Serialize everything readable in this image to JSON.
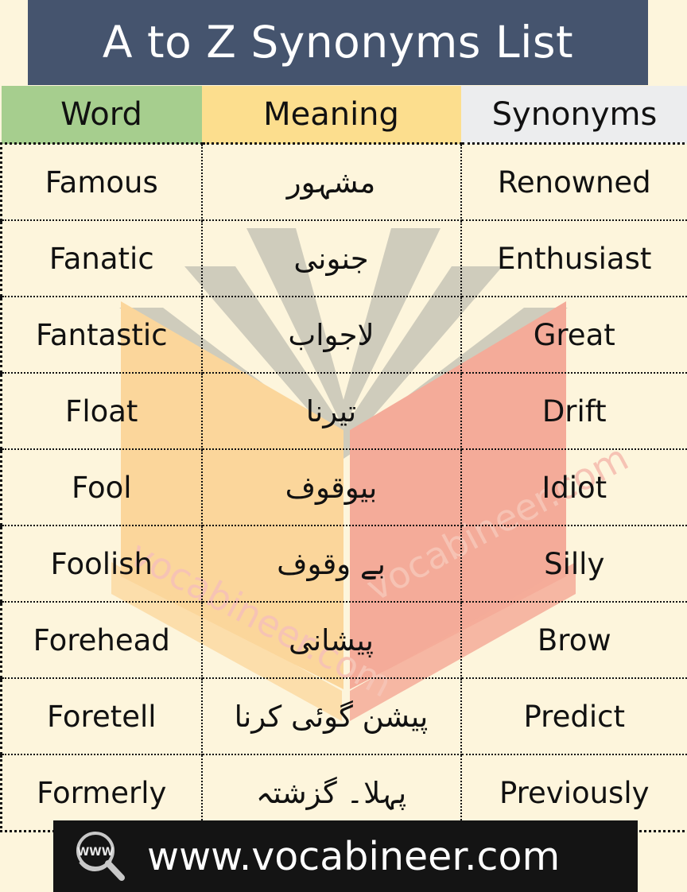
{
  "header": {
    "title": "A to Z Synonyms List",
    "title_bg": "#45546E",
    "title_color": "#FFFFFF"
  },
  "table": {
    "columns": [
      {
        "label": "Word",
        "bg": "#A6CE8E"
      },
      {
        "label": "Meaning",
        "bg": "#FCDE8E"
      },
      {
        "label": "Synonyms",
        "bg": "#ECEDEE"
      }
    ],
    "rows": [
      {
        "word": "Famous",
        "meaning": "مشہور",
        "synonym": "Renowned"
      },
      {
        "word": "Fanatic",
        "meaning": "جنونی",
        "synonym": "Enthusiast"
      },
      {
        "word": "Fantastic",
        "meaning": "لاجواب",
        "synonym": "Great"
      },
      {
        "word": "Float",
        "meaning": "تیرنا",
        "synonym": "Drift"
      },
      {
        "word": "Fool",
        "meaning": "بیوقوف",
        "synonym": "Idiot"
      },
      {
        "word": "Foolish",
        "meaning": "بے وقوف",
        "synonym": "Silly"
      },
      {
        "word": "Forehead",
        "meaning": "پیشانی",
        "synonym": "Brow"
      },
      {
        "word": "Foretell",
        "meaning": "پیشن گوئی کرنا",
        "synonym": "Predict"
      },
      {
        "word": "Formerly",
        "meaning": "پہلا۔ گزشتہ",
        "synonym": "Previously"
      }
    ]
  },
  "watermark": {
    "text": "vocabineer.com",
    "left_page_color": "#FBD69B",
    "right_page_color": "#F4AB99",
    "fan_color": "#CFCCBC",
    "text_color": "#F6C3B4"
  },
  "footer": {
    "icon": "www-magnifier-icon",
    "icon_label": "WWW",
    "url": "www.vocabineer.com",
    "bg": "#141414",
    "text_color": "#FFFFFF"
  },
  "page": {
    "background": "#FDF5DC"
  }
}
